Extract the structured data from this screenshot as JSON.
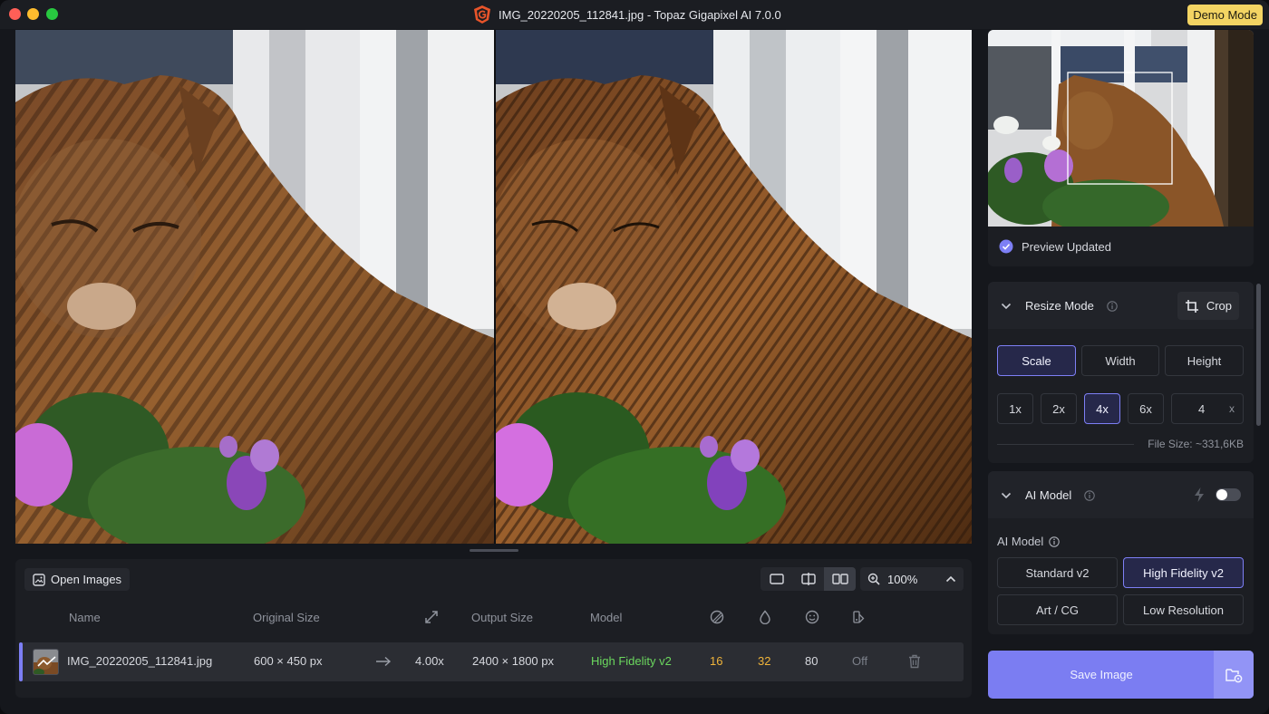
{
  "window": {
    "title": "IMG_20220205_112841.jpg - Topaz Gigapixel AI 7.0.0",
    "demo_badge": "Demo Mode"
  },
  "files": {
    "open_label": "Open Images",
    "columns": {
      "name": "Name",
      "original_size": "Original Size",
      "output_size": "Output Size",
      "model": "Model"
    },
    "row": {
      "name": "IMG_20220205_112841.jpg",
      "original_size": "600 × 450 px",
      "scale": "4.00x",
      "output_size": "2400 × 1800 px",
      "model": "High Fidelity v2",
      "denoise": "16",
      "sharpen": "32",
      "face_recovery": "80",
      "color_correction": "Off"
    }
  },
  "view": {
    "zoom": "100%",
    "active_mode": "side-by-side"
  },
  "navigator": {
    "status": "Preview Updated"
  },
  "resize": {
    "title": "Resize Mode",
    "crop_label": "Crop",
    "modes": [
      "Scale",
      "Width",
      "Height"
    ],
    "active_mode": "Scale",
    "scales": [
      "1x",
      "2x",
      "4x",
      "6x"
    ],
    "active_scale": "4x",
    "custom_value": "4",
    "custom_unit": "x",
    "file_size": "File Size: ~331,6KB"
  },
  "ai_model": {
    "title": "AI Model",
    "subtitle": "AI Model",
    "models": [
      "Standard v2",
      "High Fidelity v2",
      "Art / CG",
      "Low Resolution"
    ],
    "active_model": "High Fidelity v2",
    "autopilot_enabled": false
  },
  "save": {
    "label": "Save Image"
  },
  "colors": {
    "accent": "#7d7ff5",
    "model_green": "#6bd85e",
    "value_orange": "#f0b43a",
    "demo_yellow": "#f3d463"
  }
}
